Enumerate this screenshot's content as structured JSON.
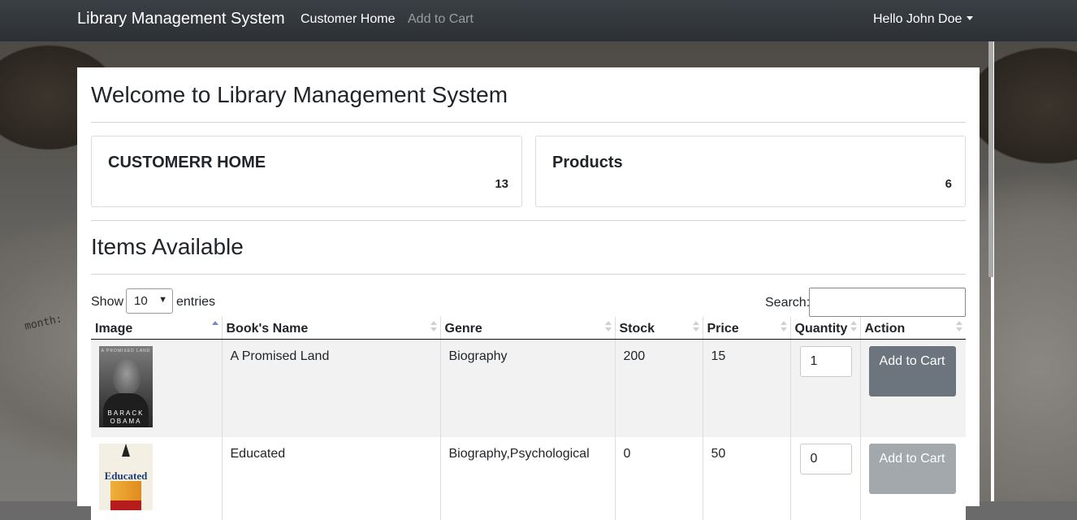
{
  "navbar": {
    "brand": "Library Management System",
    "links": [
      "Customer Home",
      "Add to Cart"
    ],
    "user": "Hello John Doe"
  },
  "background": {
    "text": "month:"
  },
  "page": {
    "welcome": "Welcome to Library Management System",
    "cards": [
      {
        "title": "CUSTOMERR HOME",
        "count": "13"
      },
      {
        "title": "Products",
        "count": "6"
      }
    ],
    "items_title": "Items Available"
  },
  "table_controls": {
    "show_label": "Show",
    "entries_select": "10",
    "entries_label": "entries",
    "search_label": "Search:",
    "search_value": ""
  },
  "table": {
    "columns": [
      "Image",
      "Book's Name",
      "Genre",
      "Stock",
      "Price",
      "Quantity",
      "Action"
    ],
    "rows": [
      {
        "image_text_top": "A PROMISED LAND",
        "image_text_bottom": "BARACK OBAMA",
        "name": "A Promised Land",
        "genre": "Biography",
        "stock": "200",
        "price": "15",
        "quantity": "1",
        "action": "Add to Cart"
      },
      {
        "image_text_top": "Educated",
        "name": "Educated",
        "genre": "Biography,Psychological",
        "stock": "0",
        "price": "50",
        "quantity": "0",
        "action": "Add to Cart"
      }
    ]
  },
  "colors": {
    "navbar": "#343a40",
    "button_active": "#6c757d",
    "button_disabled": "#a3a8ad"
  }
}
